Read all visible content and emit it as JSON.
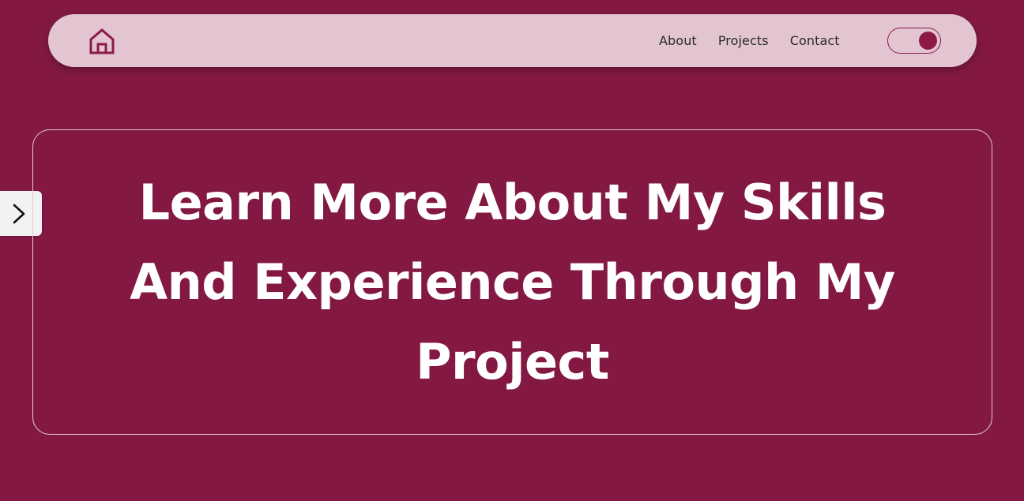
{
  "nav": {
    "home_icon": "house-icon",
    "links": [
      {
        "label": "About"
      },
      {
        "label": "Projects"
      },
      {
        "label": "Contact"
      }
    ],
    "theme_toggle": {
      "state": "on"
    }
  },
  "side_arrow": {
    "icon": "chevron-right-icon"
  },
  "hero": {
    "heading": "Learn More About My Skills And Experience Through My Project"
  },
  "colors": {
    "background": "#831942",
    "navbar": "#e2c5d1",
    "accent": "#8d1a45",
    "card_border": "#e6c7d3",
    "heading_text": "#ffffff"
  }
}
